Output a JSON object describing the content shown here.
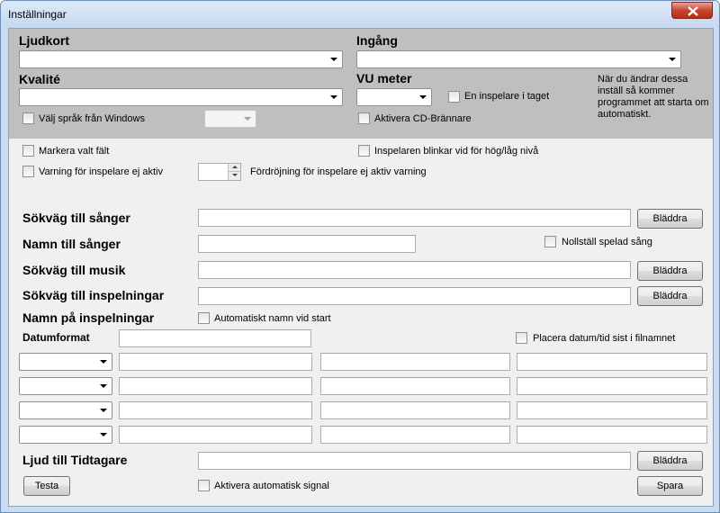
{
  "window": {
    "title": "Inställningar",
    "close_icon": "close-icon"
  },
  "top_panel": {
    "ljudkort_label": "Ljudkort",
    "ljudkort_value": "",
    "ingang_label": "Ingång",
    "ingang_value": "",
    "kvalite_label": "Kvalité",
    "kvalite_value": "",
    "vu_label": "VU meter",
    "vu_value": "",
    "en_inspelare_label": "En inspelare i taget",
    "valj_sprak_label": "Välj språk från Windows",
    "language_value": "",
    "cd_label": "Aktivera CD-Brännare",
    "restart_note": "När du ändrar dessa inställ så kommer programmet att starta om automatiskt."
  },
  "options": {
    "markera_label": "Markera valt fält",
    "inspelaren_blinkar_label": "Inspelaren blinkar vid för hög/låg nivå",
    "varning_label": "Varning för inspelare ej aktiv",
    "delay_value": "",
    "fordrojning_label": "Fördröjning för inspelare ej aktiv varning"
  },
  "paths": {
    "sokvag_sanger_label": "Sökväg till sånger",
    "sokvag_sanger_value": "",
    "namn_sanger_label": "Namn till sånger",
    "namn_sanger_value": "",
    "nollstall_label": "Nollställ spelad sång",
    "sokvag_musik_label": "Sökväg till musik",
    "sokvag_musik_value": "",
    "sokvag_inspelningar_label": "Sökväg till inspelningar",
    "sokvag_inspelningar_value": "",
    "namn_inspelningar_label": "Namn på inspelningar",
    "auto_namn_label": "Automatiskt namn vid start",
    "datumformat_label": "Datumformat",
    "datumformat_value": "",
    "placera_datum_label": "Placera datum/tid sist i filnamnet",
    "ljud_tidtagare_label": "Ljud till Tidtagare",
    "ljud_tidtagare_value": "",
    "browse_label": "Bläddra"
  },
  "name_rows": [
    {
      "combo": "",
      "f1": "",
      "f2": "",
      "f3": ""
    },
    {
      "combo": "",
      "f1": "",
      "f2": "",
      "f3": ""
    },
    {
      "combo": "",
      "f1": "",
      "f2": "",
      "f3": ""
    },
    {
      "combo": "",
      "f1": "",
      "f2": "",
      "f3": ""
    }
  ],
  "bottom": {
    "testa_label": "Testa",
    "auto_signal_label": "Aktivera automatisk signal",
    "spara_label": "Spara"
  }
}
